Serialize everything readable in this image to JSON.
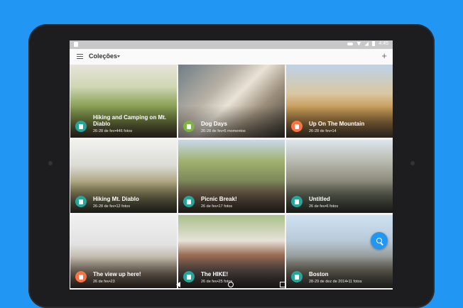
{
  "statusbar": {
    "time": "4:45"
  },
  "appbar": {
    "title": "Coleções",
    "add_label": "+"
  },
  "colors": {
    "background": "#2196f3",
    "fab": "#2196f3",
    "badge_teal": "#26a69a",
    "badge_green": "#7cb342",
    "badge_orange": "#ff7043"
  },
  "collections": [
    {
      "title": "Hiking and Camping on Mt. Diablo",
      "subtitle": "26-28 de fev•446 fotos",
      "badge_color": "#26a69a",
      "icon": "album-icon"
    },
    {
      "title": "Dog Days",
      "subtitle": "26-28 de fev•5 momentos",
      "badge_color": "#7cb342",
      "icon": "album-icon"
    },
    {
      "title": "Up On The Mountain",
      "subtitle": "26-28 de fev•14",
      "badge_color": "#ff7043",
      "icon": "album-icon"
    },
    {
      "title": "Hiking Mt. Diablo",
      "subtitle": "26-28 de fev•12 fotos",
      "badge_color": "#26a69a",
      "icon": "album-icon"
    },
    {
      "title": "Picnic Break!",
      "subtitle": "26 de fev•17 fotos",
      "badge_color": "#26a69a",
      "icon": "album-icon"
    },
    {
      "title": "Untitled",
      "subtitle": "26 de fev•6 fotos",
      "badge_color": "#26a69a",
      "icon": "album-icon"
    },
    {
      "title": "The view up here!",
      "subtitle": "26 de fev•23",
      "badge_color": "#ff7043",
      "icon": "album-icon"
    },
    {
      "title": "The HIKE!",
      "subtitle": "26 de fev•25 fotos",
      "badge_color": "#26a69a",
      "icon": "album-icon"
    },
    {
      "title": "Boston",
      "subtitle": "28-29 de dez de 2014•11 fotos",
      "badge_color": "#26a69a",
      "icon": "album-icon"
    }
  ]
}
